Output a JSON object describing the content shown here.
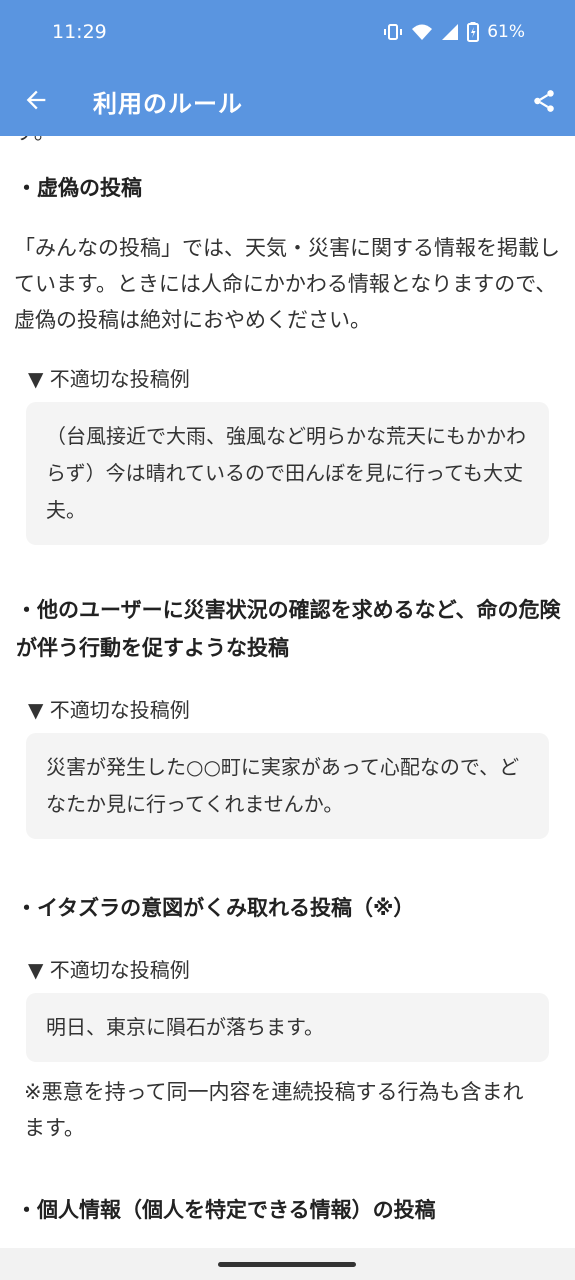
{
  "status_bar": {
    "time": "11:29",
    "battery_percent": "61%",
    "icons": [
      "vibrate-icon",
      "wifi-icon",
      "signal-icon",
      "battery-icon"
    ]
  },
  "toolbar": {
    "title": "利用のルール",
    "back_icon": "arrow-left-icon",
    "share_icon": "share-icon"
  },
  "content": {
    "cut_off_text": "す。",
    "sections": [
      {
        "heading": "・虚偽の投稿",
        "body": "「みんなの投稿」では、天気・災害に関する情報を掲載しています。ときには人命にかかわる情報となりますので、虚偽の投稿は絶対におやめください。",
        "example_label": "▼ 不適切な投稿例",
        "example": "（台風接近で大雨、強風など明らかな荒天にもかかわらず）今は晴れているので田んぼを見に行っても大丈夫。"
      },
      {
        "heading": "・他のユーザーに災害状況の確認を求めるなど、命の危険が伴う行動を促すような投稿",
        "example_label": "▼ 不適切な投稿例",
        "example": "災害が発生した○○町に実家があって心配なので、どなたか見に行ってくれませんか。"
      },
      {
        "heading": "・イタズラの意図がくみ取れる投稿（※）",
        "example_label": "▼ 不適切な投稿例",
        "example": "明日、東京に隕石が落ちます。",
        "note": "※悪意を持って同一内容を連続投稿する行為も含まれます。"
      },
      {
        "heading": "・個人情報（個人を特定できる情報）の投稿"
      }
    ]
  },
  "colors": {
    "appbar": "#5a95e0",
    "example_box": "#f4f4f4"
  }
}
